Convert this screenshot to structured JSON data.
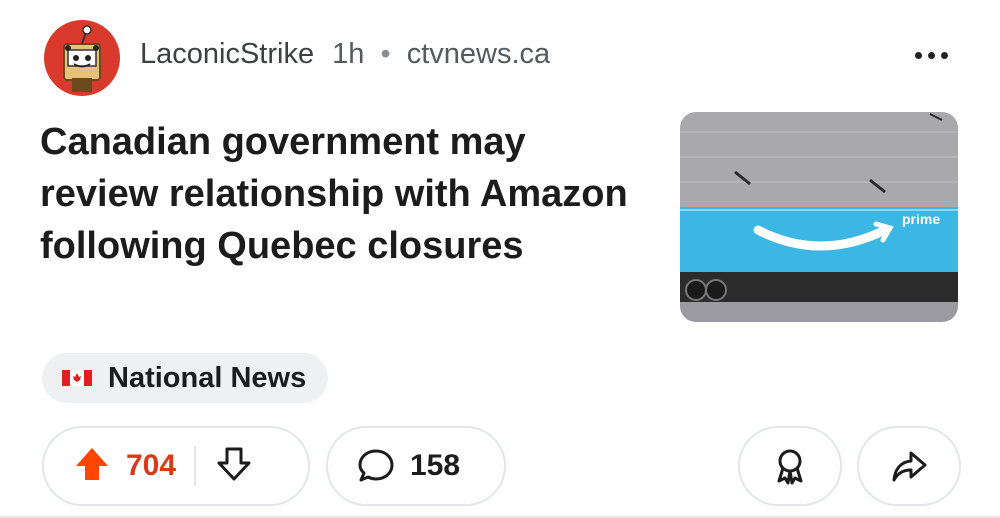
{
  "post": {
    "author": "LaconicStrike",
    "age": "1h",
    "separator": "•",
    "domain": "ctvnews.ca",
    "title": "Canadian government may review relationship with Amazon following Quebec closures",
    "flair": "National News",
    "thumbnail": {
      "text": "prime",
      "subject": "Amazon Prime trailer"
    }
  },
  "actions": {
    "upvotes": "704",
    "comments": "158"
  },
  "icons": {
    "avatar": "snoo-avatar-icon",
    "more": "more-options-icon",
    "flag": "canada-flag-icon",
    "upvote": "upvote-arrow-icon",
    "downvote": "downvote-arrow-icon",
    "comment": "comment-bubble-icon",
    "award": "award-icon",
    "share": "share-arrow-icon"
  },
  "colors": {
    "upvote_active": "#ff4500",
    "upvote_count": "#d93a19",
    "trailer_blue": "#3cb7e4",
    "avatar_bg": "#d93a2b"
  }
}
